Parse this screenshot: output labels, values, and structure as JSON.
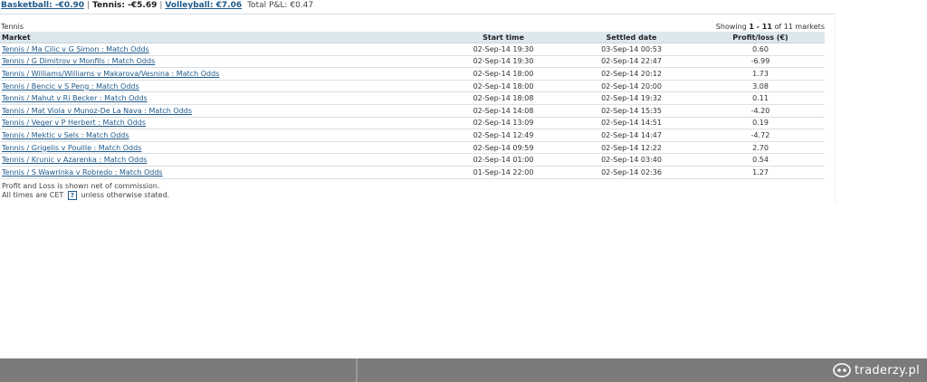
{
  "summary": {
    "basketball_label": "Basketball: -€0.90",
    "tennis_label": "Tennis: -€5.69",
    "volleyball_label": "Volleyball: €7.06",
    "separator": "|",
    "total_label": "Total P&L:",
    "total_value": "€0.47"
  },
  "section": {
    "title": "Tennis",
    "showing_prefix": "Showing",
    "showing_range": "1 - 11",
    "showing_suffix": "of 11 markets"
  },
  "table": {
    "headers": {
      "market": "Market",
      "start": "Start time",
      "settled": "Settled date",
      "pl": "Profit/loss (€)"
    },
    "rows": [
      {
        "market": "Tennis / Ma Cilic v G Simon : Match Odds",
        "start": "02-Sep-14 19:30",
        "settled": "03-Sep-14 00:53",
        "pl": "0.60"
      },
      {
        "market": "Tennis / G Dimitrov v Monfils : Match Odds",
        "start": "02-Sep-14 19:30",
        "settled": "02-Sep-14 22:47",
        "pl": "-6.99"
      },
      {
        "market": "Tennis / Williams/Williams v Makarova/Vesnina : Match Odds",
        "start": "02-Sep-14 18:00",
        "settled": "02-Sep-14 20:12",
        "pl": "1.73"
      },
      {
        "market": "Tennis / Bencic v S Peng : Match Odds",
        "start": "02-Sep-14 18:00",
        "settled": "02-Sep-14 20:00",
        "pl": "3.08"
      },
      {
        "market": "Tennis / Mahut v Ri Becker : Match Odds",
        "start": "02-Sep-14 18:08",
        "settled": "02-Sep-14 19:32",
        "pl": "0.11"
      },
      {
        "market": "Tennis / Mat Viola v Munoz-De La Nava : Match Odds",
        "start": "02-Sep-14 14:08",
        "settled": "02-Sep-14 15:35",
        "pl": "-4.20"
      },
      {
        "market": "Tennis / Veger v P Herbert : Match Odds",
        "start": "02-Sep-14 13:09",
        "settled": "02-Sep-14 14:51",
        "pl": "0.19"
      },
      {
        "market": "Tennis / Mektic v Sels : Match Odds",
        "start": "02-Sep-14 12:49",
        "settled": "02-Sep-14 14:47",
        "pl": "-4.72"
      },
      {
        "market": "Tennis / Grigelis v Pouille : Match Odds",
        "start": "02-Sep-14 09:59",
        "settled": "02-Sep-14 12:22",
        "pl": "2.70"
      },
      {
        "market": "Tennis / Krunic v Azarenka : Match Odds",
        "start": "02-Sep-14 01:00",
        "settled": "02-Sep-14 03:40",
        "pl": "0.54"
      },
      {
        "market": "Tennis / S Wawrinka v Robredo : Match Odds",
        "start": "01-Sep-14 22:00",
        "settled": "02-Sep-14 02:36",
        "pl": "1.27"
      }
    ]
  },
  "notes": {
    "commission": "Profit and Loss is shown net of commission.",
    "times_prefix": "All times are CET",
    "help_label": "?",
    "times_suffix": "unless otherwise stated."
  },
  "footer": {
    "brand": "traderzy.pl",
    "brand_icon": "robot-face-icon",
    "background_color": "#7b7b7b"
  }
}
